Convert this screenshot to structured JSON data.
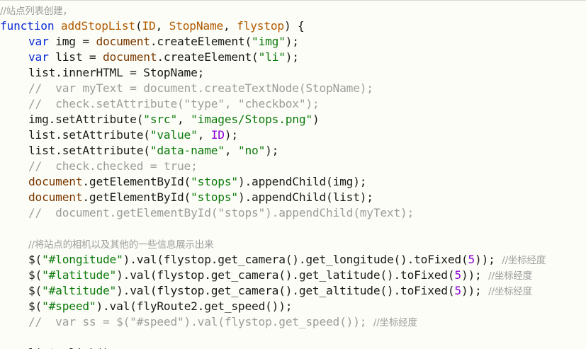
{
  "code_lines": [
    {
      "indent": 0,
      "tokens": [
        {
          "t": "//站点列表创建，",
          "c": "c-cjk"
        }
      ]
    },
    {
      "indent": 0,
      "tokens": [
        {
          "t": "function",
          "c": "c-kw"
        },
        {
          "t": " ",
          "c": "c-text"
        },
        {
          "t": "addStopList",
          "c": "c-fn"
        },
        {
          "t": "(",
          "c": "c-text"
        },
        {
          "t": "ID",
          "c": "c-param"
        },
        {
          "t": ", ",
          "c": "c-text"
        },
        {
          "t": "StopName",
          "c": "c-param"
        },
        {
          "t": ", ",
          "c": "c-text"
        },
        {
          "t": "flystop",
          "c": "c-param"
        },
        {
          "t": ") {",
          "c": "c-text"
        }
      ]
    },
    {
      "indent": 1,
      "tokens": [
        {
          "t": "var",
          "c": "c-kw"
        },
        {
          "t": " img = ",
          "c": "c-text"
        },
        {
          "t": "document",
          "c": "c-obj"
        },
        {
          "t": ".createElement(",
          "c": "c-text"
        },
        {
          "t": "\"img\"",
          "c": "c-str"
        },
        {
          "t": ");",
          "c": "c-text"
        }
      ]
    },
    {
      "indent": 1,
      "tokens": [
        {
          "t": "var",
          "c": "c-kw"
        },
        {
          "t": " list = ",
          "c": "c-text"
        },
        {
          "t": "document",
          "c": "c-obj"
        },
        {
          "t": ".createElement(",
          "c": "c-text"
        },
        {
          "t": "\"li\"",
          "c": "c-str"
        },
        {
          "t": ");",
          "c": "c-text"
        }
      ]
    },
    {
      "indent": 1,
      "tokens": [
        {
          "t": "list.innerHTML = StopName;",
          "c": "c-text"
        }
      ]
    },
    {
      "indent": 1,
      "tokens": [
        {
          "t": "//  var myText = document.createTextNode(StopName);",
          "c": "c-cmt"
        }
      ]
    },
    {
      "indent": 1,
      "tokens": [
        {
          "t": "//  check.setAttribute(\"type\", \"checkbox\");",
          "c": "c-cmt"
        }
      ]
    },
    {
      "indent": 1,
      "tokens": [
        {
          "t": "img.setAttribute(",
          "c": "c-text"
        },
        {
          "t": "\"src\"",
          "c": "c-str"
        },
        {
          "t": ", ",
          "c": "c-text"
        },
        {
          "t": "\"images/Stops.png\"",
          "c": "c-str"
        },
        {
          "t": ")",
          "c": "c-text"
        }
      ]
    },
    {
      "indent": 1,
      "tokens": [
        {
          "t": "list.setAttribute(",
          "c": "c-text"
        },
        {
          "t": "\"value\"",
          "c": "c-str"
        },
        {
          "t": ", ",
          "c": "c-text"
        },
        {
          "t": "ID",
          "c": "c-id"
        },
        {
          "t": ");",
          "c": "c-text"
        }
      ]
    },
    {
      "indent": 1,
      "tokens": [
        {
          "t": "list.setAttribute(",
          "c": "c-text"
        },
        {
          "t": "\"data-name\"",
          "c": "c-str"
        },
        {
          "t": ", ",
          "c": "c-text"
        },
        {
          "t": "\"no\"",
          "c": "c-str"
        },
        {
          "t": ");",
          "c": "c-text"
        }
      ]
    },
    {
      "indent": 1,
      "tokens": [
        {
          "t": "//  check.checked = true;",
          "c": "c-cmt"
        }
      ]
    },
    {
      "indent": 1,
      "tokens": [
        {
          "t": "document",
          "c": "c-obj"
        },
        {
          "t": ".getElementById(",
          "c": "c-text"
        },
        {
          "t": "\"stops\"",
          "c": "c-str"
        },
        {
          "t": ").appendChild(img);",
          "c": "c-text"
        }
      ]
    },
    {
      "indent": 1,
      "tokens": [
        {
          "t": "document",
          "c": "c-obj"
        },
        {
          "t": ".getElementById(",
          "c": "c-text"
        },
        {
          "t": "\"stops\"",
          "c": "c-str"
        },
        {
          "t": ").appendChild(list);",
          "c": "c-text"
        }
      ]
    },
    {
      "indent": 1,
      "tokens": [
        {
          "t": "//  document.getElementById(\"stops\").appendChild(myText);",
          "c": "c-cmt"
        }
      ]
    },
    {
      "indent": 0,
      "tokens": []
    },
    {
      "indent": 1,
      "tokens": [
        {
          "t": "//将站点的相机以及其他的一些信息展示出来",
          "c": "c-cjk"
        }
      ]
    },
    {
      "indent": 1,
      "tokens": [
        {
          "t": "$(",
          "c": "c-text"
        },
        {
          "t": "\"#longitude\"",
          "c": "c-str"
        },
        {
          "t": ").val(flystop.get_camera().get_longitude().toFixed(",
          "c": "c-text"
        },
        {
          "t": "5",
          "c": "c-num"
        },
        {
          "t": ")); ",
          "c": "c-text"
        },
        {
          "t": "//坐标经度",
          "c": "c-cjk"
        }
      ]
    },
    {
      "indent": 1,
      "tokens": [
        {
          "t": "$(",
          "c": "c-text"
        },
        {
          "t": "\"#latitude\"",
          "c": "c-str"
        },
        {
          "t": ").val(flystop.get_camera().get_latitude().toFixed(",
          "c": "c-text"
        },
        {
          "t": "5",
          "c": "c-num"
        },
        {
          "t": ")); ",
          "c": "c-text"
        },
        {
          "t": "//坐标经度",
          "c": "c-cjk"
        }
      ]
    },
    {
      "indent": 1,
      "tokens": [
        {
          "t": "$(",
          "c": "c-text"
        },
        {
          "t": "\"#altitude\"",
          "c": "c-str"
        },
        {
          "t": ").val(flystop.get_camera().get_altitude().toFixed(",
          "c": "c-text"
        },
        {
          "t": "5",
          "c": "c-num"
        },
        {
          "t": ")); ",
          "c": "c-text"
        },
        {
          "t": "//坐标经度",
          "c": "c-cjk"
        }
      ]
    },
    {
      "indent": 1,
      "tokens": [
        {
          "t": "$(",
          "c": "c-text"
        },
        {
          "t": "\"#speed\"",
          "c": "c-str"
        },
        {
          "t": ").val(flyRoute2.get_speed());",
          "c": "c-text"
        }
      ]
    },
    {
      "indent": 1,
      "tokens": [
        {
          "t": "//  var ss = $(\"#speed\").val(flystop.get_speed()); ",
          "c": "c-cmt"
        },
        {
          "t": "//坐标经度",
          "c": "c-cjk"
        }
      ]
    },
    {
      "indent": 0,
      "tokens": []
    },
    {
      "indent": 1,
      "tokens": [
        {
          "t": "list.click()",
          "c": "c-text"
        }
      ]
    }
  ],
  "colors": {
    "background": "#fdfdf7",
    "keyword": "#0b2bd6",
    "function_name": "#b05a00",
    "string": "#0a7a0a",
    "number": "#8a00d6",
    "comment": "#9c9c9c"
  }
}
